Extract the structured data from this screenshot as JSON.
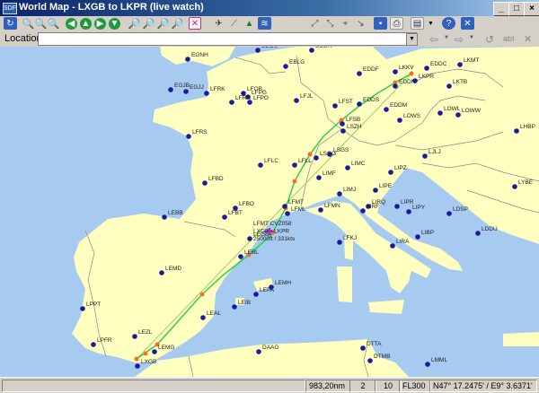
{
  "window": {
    "title": "World Map - LXGB to LKPR (live watch)",
    "app_icon_text": "SDF"
  },
  "location": {
    "label": "Location",
    "value": ""
  },
  "toolbar_icons": [
    "refresh",
    "zoom-in",
    "zoom-out",
    "zoom-fit",
    "back",
    "up",
    "forward",
    "down",
    "zoom-in-2",
    "zoom-out-2",
    "zoom-route",
    "zoom-area",
    "routing",
    "airport",
    "airspace",
    "navaids",
    "grid",
    "labels",
    "save",
    "print",
    "export",
    "settings",
    "help",
    "close"
  ],
  "map": {
    "sea_color": "#a6caf0",
    "land_color": "#ffffc0",
    "border_color": "#8a8a8a",
    "airport_color": "#1a1a9c",
    "route_color": "#2ad04a",
    "waypoint_color": "#ff6a28",
    "aircraft_label_lines": [
      "LFMT CVZ058",
      "LXGB - LKPR",
      "25000ft / 331kts"
    ],
    "airports": [
      {
        "code": "EGNH"
      },
      {
        "code": "EBOS"
      },
      {
        "code": "EDDK"
      },
      {
        "code": "EBLG"
      },
      {
        "code": "EDDF"
      },
      {
        "code": "EDDN"
      },
      {
        "code": "EGJB"
      },
      {
        "code": "EGJJ"
      },
      {
        "code": "LFRK"
      },
      {
        "code": "LFOB"
      },
      {
        "code": "LFPG"
      },
      {
        "code": "LFPO"
      },
      {
        "code": "LFRH"
      },
      {
        "code": "LFJL"
      },
      {
        "code": "LFST"
      },
      {
        "code": "EDDS"
      },
      {
        "code": "LFSB"
      },
      {
        "code": "LSZH"
      },
      {
        "code": "EDDM"
      },
      {
        "code": "LOWS"
      },
      {
        "code": "LOWL"
      },
      {
        "code": "LKPR"
      },
      {
        "code": "LKMT"
      },
      {
        "code": "LKTB"
      },
      {
        "code": "LOWW"
      },
      {
        "code": "LHBP"
      },
      {
        "code": "LFRS"
      },
      {
        "code": "LFLC"
      },
      {
        "code": "LFLL"
      },
      {
        "code": "LSGG"
      },
      {
        "code": "LSGS"
      },
      {
        "code": "LIMF"
      },
      {
        "code": "LIMC"
      },
      {
        "code": "LIPZ"
      },
      {
        "code": "LJLJ"
      },
      {
        "code": "LFBD"
      },
      {
        "code": "LFMT"
      },
      {
        "code": "LFBO"
      },
      {
        "code": "LFBT"
      },
      {
        "code": "LFMN"
      },
      {
        "code": "LIMJ"
      },
      {
        "code": "LIPE"
      },
      {
        "code": "LIRQ"
      },
      {
        "code": "LIPR"
      },
      {
        "code": "LIPY"
      },
      {
        "code": "LDSP"
      },
      {
        "code": "LYBE"
      },
      {
        "code": "LEBB"
      },
      {
        "code": "LFML"
      },
      {
        "code": "LFKJ"
      },
      {
        "code": "LIRF"
      },
      {
        "code": "LIBP"
      },
      {
        "code": "LDDU"
      },
      {
        "code": "LEGE"
      },
      {
        "code": "LEBL"
      },
      {
        "code": "LIRA"
      },
      {
        "code": "LEMD"
      },
      {
        "code": "LEPA"
      },
      {
        "code": "LEMH"
      },
      {
        "code": "LEIB"
      },
      {
        "code": "LEAL"
      },
      {
        "code": "LPPT"
      },
      {
        "code": "LEZL"
      },
      {
        "code": "LPFR"
      },
      {
        "code": "LEMG"
      },
      {
        "code": "LXGB"
      },
      {
        "code": "DAAG"
      },
      {
        "code": "DTTA"
      },
      {
        "code": "DTMB"
      },
      {
        "code": "LMML"
      },
      {
        "code": "LKKV"
      },
      {
        "code": "EDDC"
      }
    ]
  },
  "status": {
    "cell1": "",
    "cell2": "983,20nm",
    "cell3": "2",
    "cell4": "10",
    "cell5": "FL300",
    "cell6": "N47° 17.2475' / E9° 3.6371'"
  }
}
